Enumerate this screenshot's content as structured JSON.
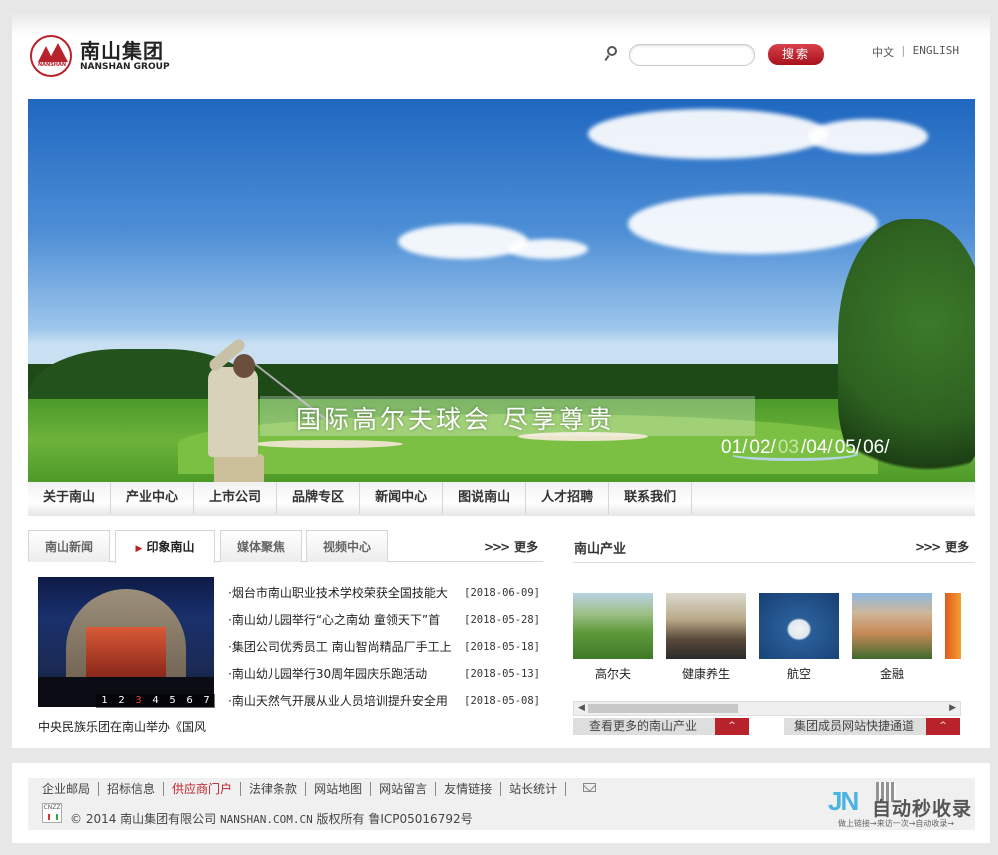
{
  "header": {
    "logo_cn": "南山集团",
    "logo_en": "NANSHAN GROUP",
    "logo_seal": "NANSHAN",
    "search_placeholder": "",
    "search_button": "搜索",
    "lang_cn": "中文",
    "lang_sep": "|",
    "lang_en": "ENGLISH"
  },
  "banner": {
    "caption": "国际高尔夫球会 尽享尊贵",
    "pages": [
      "01/",
      "02/",
      "03",
      "/04/",
      "05/",
      "06/"
    ],
    "active_page": 3
  },
  "nav": {
    "items": [
      "关于南山",
      "产业中心",
      "上市公司",
      "品牌专区",
      "新闻中心",
      "图说南山",
      "人才招聘",
      "联系我们"
    ]
  },
  "news": {
    "tabs": [
      "南山新闻",
      "印象南山",
      "媒体聚焦",
      "视频中心"
    ],
    "active_tab": "印象南山",
    "more": "更多",
    "more_arrows": ">>>",
    "photo_pager": [
      "1",
      "2",
      "3",
      "4",
      "5",
      "6",
      "7"
    ],
    "photo_active": "3",
    "photo_caption": "中央民族乐团在南山举办《国风",
    "items": [
      {
        "title": "·烟台市南山职业技术学校荣获全国技能大",
        "date": "[2018-06-09]"
      },
      {
        "title": "·南山幼儿园举行“心之南幼 童领天下”首",
        "date": "[2018-05-28]"
      },
      {
        "title": "·集团公司优秀员工 南山智尚精品厂手工上",
        "date": "[2018-05-18]"
      },
      {
        "title": "·南山幼儿园举行30周年园庆乐跑活动",
        "date": "[2018-05-13]"
      },
      {
        "title": "·南山天然气开展从业人员培训提升安全用",
        "date": "[2018-05-08]"
      }
    ]
  },
  "industry": {
    "title": "南山产业",
    "more": "更多",
    "more_arrows": ">>>",
    "items": [
      {
        "label": "高尔夫",
        "icon": "golf-course-thumb"
      },
      {
        "label": "健康养生",
        "icon": "temple-thumb"
      },
      {
        "label": "航空",
        "icon": "airplane-thumb"
      },
      {
        "label": "金融",
        "icon": "building-thumb"
      }
    ],
    "scroll_fraction": 0.4,
    "more_bar_left": "查看更多的南山产业",
    "more_bar_right": "集团成员网站快捷通道",
    "caret": "^"
  },
  "footer": {
    "links": [
      "企业邮局",
      "招标信息",
      "供应商门户",
      "法律条款",
      "网站地图",
      "网站留言",
      "友情链接",
      "站长统计"
    ],
    "highlight": "供应商门户",
    "copyright_prefix": "© 2014 南山集团有限公司",
    "copyright_domain": "NANSHAN.COM.CN",
    "copyright_suffix": "版权所有 鲁ICP05016792号",
    "cert_label": "CNZZ"
  },
  "watermark": {
    "logo": "JN",
    "text": "自动秒收录",
    "sub": "做上链接→来访一次→自动收录→"
  },
  "colors": {
    "brand_red": "#b8222b",
    "nav_bg": "#f2f2f2"
  }
}
